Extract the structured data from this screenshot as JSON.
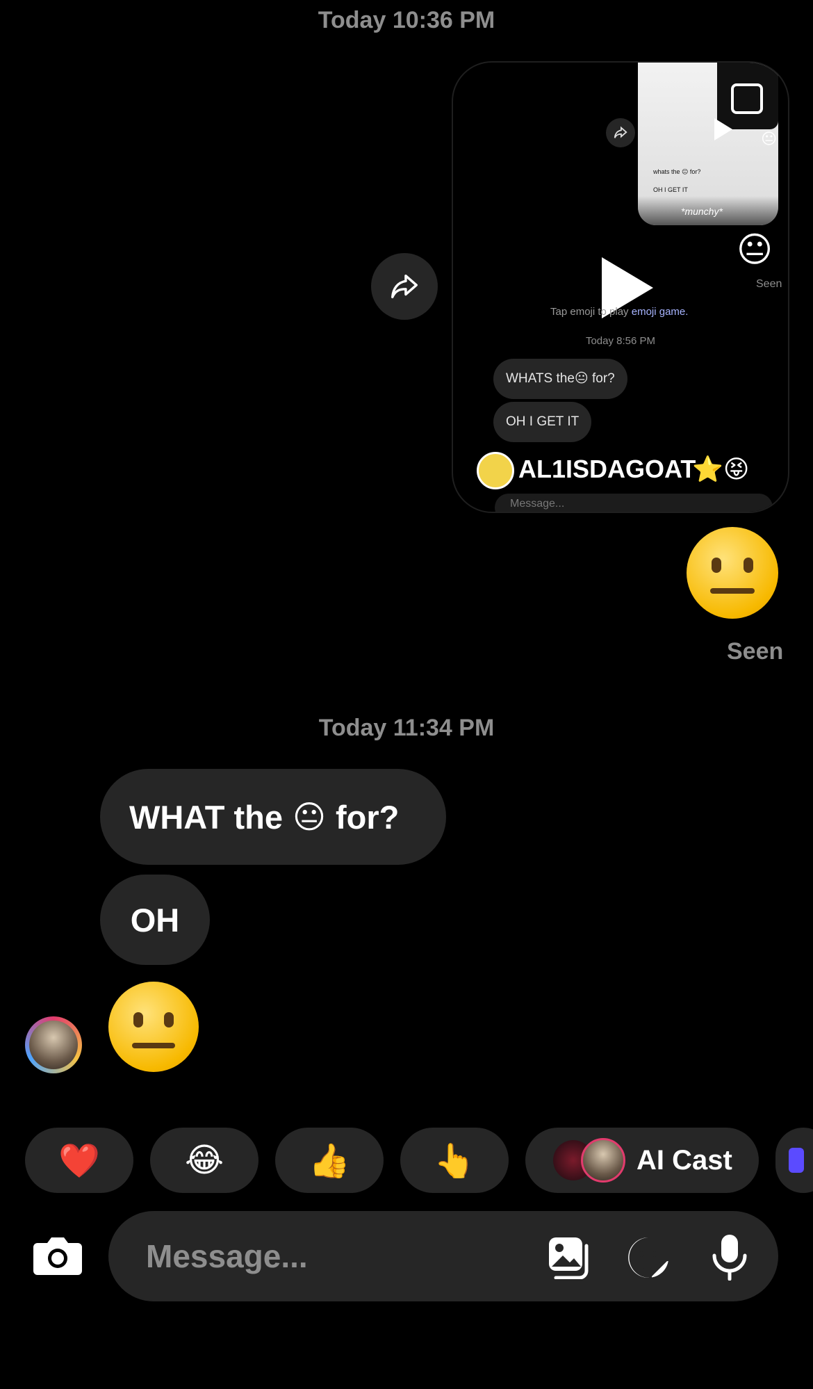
{
  "thread": {
    "timestamp_1": "Today 10:36 PM",
    "timestamp_2": "Today 11:34 PM",
    "seen_label": "Seen",
    "sent_emoji": "😐",
    "received": {
      "message_1_prefix": "WHAT the",
      "message_1_emoji": "😐",
      "message_1_suffix": "for?",
      "message_2": "OH",
      "message_3_emoji": "😐"
    }
  },
  "reel_preview": {
    "username": "AL1ISDAGOAT",
    "username_suffix": "⭐😝",
    "inner_hint_prefix": "Tap emoji to play",
    "inner_hint_link": "emoji game.",
    "inner_timestamp": "Today 8:56 PM",
    "inner_bubble_1": "WHATS the😐 for?",
    "inner_bubble_2": "OH I GET IT",
    "inner_seen": "Seen",
    "inner_emoji": "😐",
    "inner_message_placeholder": "Message...",
    "thumb_text_1": "whats the 😐 for?",
    "thumb_text_2": "OH I GET IT",
    "thumb_name": "*munchy*"
  },
  "quick_reactions": {
    "items": [
      "❤️",
      "😂",
      "👍",
      "👆"
    ],
    "ai_cast_label": "AI Cast"
  },
  "composer": {
    "placeholder": "Message..."
  },
  "colors": {
    "background": "#000000",
    "bubble": "#262626",
    "secondary_text": "#8e8e8e",
    "link": "#a7b4ff"
  },
  "icons": [
    "share-icon",
    "play-icon",
    "camera-icon",
    "gallery-icon",
    "sticker-icon",
    "microphone-icon"
  ]
}
